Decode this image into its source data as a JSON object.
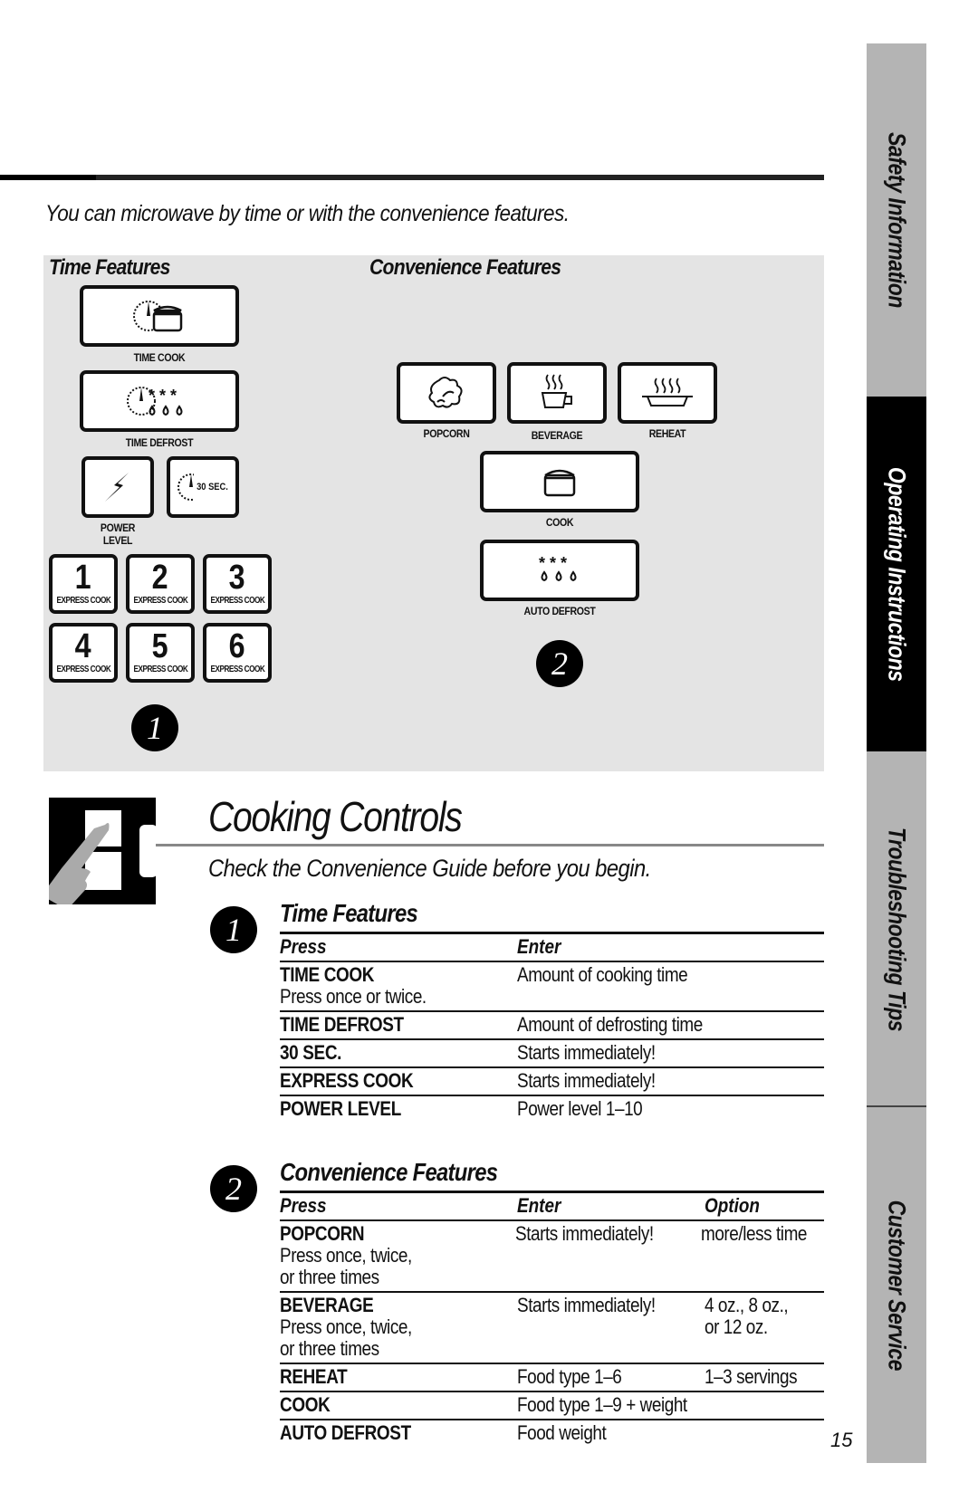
{
  "intro": "You can microwave by time or with the convenience features.",
  "panel": {
    "time_features_heading": "Time Features",
    "convenience_features_heading": "Convenience Features",
    "time_keys": {
      "time_cook": "TIME COOK",
      "time_defrost": "TIME DEFROST",
      "power_level_line1": "POWER",
      "power_level_line2": "LEVEL",
      "thirty_sec": "30 SEC."
    },
    "express_keys": [
      {
        "digit": "1",
        "label": "EXPRESS COOK"
      },
      {
        "digit": "2",
        "label": "EXPRESS COOK"
      },
      {
        "digit": "3",
        "label": "EXPRESS COOK"
      },
      {
        "digit": "4",
        "label": "EXPRESS COOK"
      },
      {
        "digit": "5",
        "label": "EXPRESS COOK"
      },
      {
        "digit": "6",
        "label": "EXPRESS COOK"
      }
    ],
    "convenience_keys": {
      "popcorn": "POPCORN",
      "beverage": "BEVERAGE",
      "reheat": "REHEAT",
      "cook": "COOK",
      "auto_defrost": "AUTO DEFROST"
    },
    "badge_1": "1",
    "badge_2": "2"
  },
  "tabs": [
    {
      "label": "Safety Information",
      "active": false
    },
    {
      "label": "Operating Instructions",
      "active": true
    },
    {
      "label": "Troubleshooting Tips",
      "active": false
    },
    {
      "label": "Customer Service",
      "active": false
    }
  ],
  "title": "Cooking Controls",
  "subtitle": "Check the Convenience Guide before you begin.",
  "time_features": {
    "badge": "1",
    "heading": "Time Features",
    "columns": [
      "Press",
      "Enter"
    ],
    "rows": [
      {
        "press": "TIME COOK",
        "note": "Press once or twice.",
        "enter": "Amount of cooking time"
      },
      {
        "press": "TIME DEFROST",
        "enter": "Amount of defrosting time"
      },
      {
        "press": "30 SEC.",
        "enter": "Starts immediately!"
      },
      {
        "press": "EXPRESS COOK",
        "enter": "Starts immediately!"
      },
      {
        "press": "POWER LEVEL",
        "enter": "Power level 1–10"
      }
    ]
  },
  "convenience_features": {
    "badge": "2",
    "heading": "Convenience Features",
    "columns": [
      "Press",
      "Enter",
      "Option"
    ],
    "rows": [
      {
        "press": "POPCORN",
        "note1": "Press once, twice,",
        "note2": "or three times",
        "enter": "Starts immediately!",
        "option1": "more/less time"
      },
      {
        "press": "BEVERAGE",
        "note1": "Press once, twice,",
        "note2": "or three times",
        "enter": "Starts immediately!",
        "option1": "4 oz., 8 oz.,",
        "option2": "or 12 oz."
      },
      {
        "press": "REHEAT",
        "enter": "Food type 1–6",
        "option1": "1–3 servings"
      },
      {
        "press": "COOK",
        "enter": "Food type 1–9 + weight"
      },
      {
        "press": "AUTO DEFROST",
        "enter": "Food weight"
      }
    ]
  },
  "page_number": "15"
}
